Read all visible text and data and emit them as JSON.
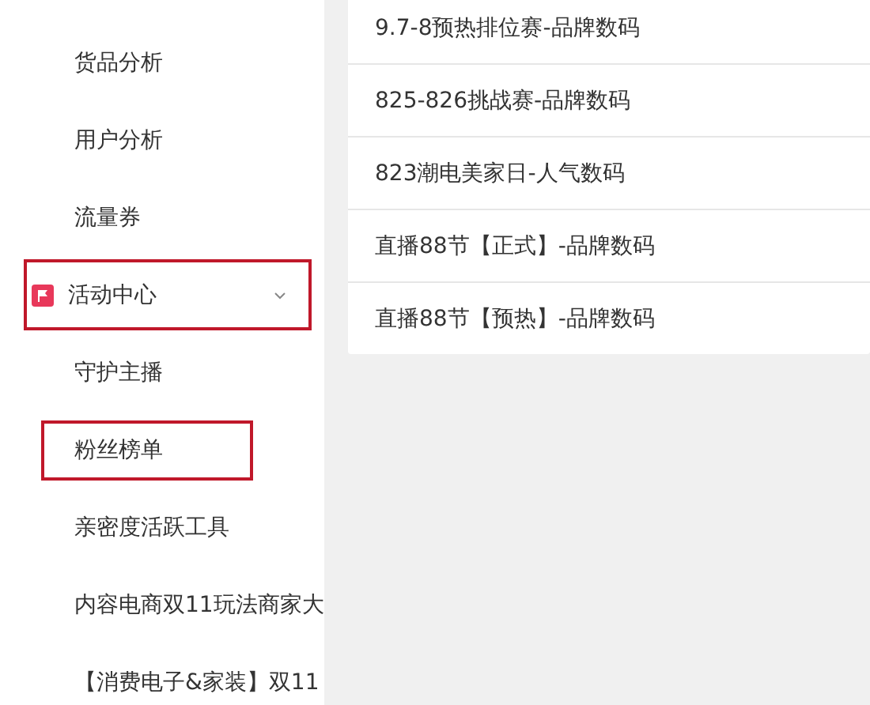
{
  "sidebar": {
    "items": [
      {
        "label": "货品分析",
        "kind": "link",
        "highlighted": false
      },
      {
        "label": "用户分析",
        "kind": "link",
        "highlighted": false
      },
      {
        "label": "流量券",
        "kind": "link",
        "highlighted": false
      },
      {
        "label": "活动中心",
        "kind": "group",
        "expanded": true,
        "highlighted": true
      },
      {
        "label": "守护主播",
        "kind": "link",
        "highlighted": false
      },
      {
        "label": "粉丝榜单",
        "kind": "link",
        "highlighted": true
      },
      {
        "label": "亲密度活跃工具",
        "kind": "link",
        "highlighted": false
      },
      {
        "label": "内容电商双11玩法商家大",
        "kind": "link",
        "highlighted": false
      },
      {
        "label": "【消费电子&家装】双11",
        "kind": "link",
        "highlighted": false
      }
    ]
  },
  "list": {
    "items": [
      "9.7-8预热排位赛-品牌数码",
      "825-826挑战赛-品牌数码",
      "823潮电美家日-人气数码",
      "直播88节【正式】-品牌数码",
      "直播88节【预热】-品牌数码"
    ]
  }
}
